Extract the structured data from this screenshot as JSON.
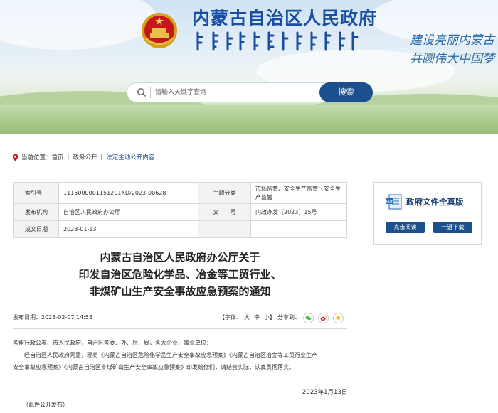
{
  "header": {
    "site_title": "内蒙古自治区人民政府",
    "slogan_line1": "建设亮丽内蒙古",
    "slogan_line2": "共圆伟大中国梦"
  },
  "search": {
    "placeholder": "请输入关键字查询",
    "button_label": "搜索"
  },
  "breadcrumb": {
    "prefix": "当前位置：",
    "items": [
      "首页",
      "政务公开",
      "法定主动公开内容"
    ]
  },
  "meta": {
    "index_label": "索引号",
    "index_value": "1115000001151201XD/2023-00628",
    "category_label": "主题分类",
    "category_value": "市场监管、安全生产监管＼安全生产监管",
    "publisher_label": "发布机构",
    "publisher_value": "自治区人民政府办公厅",
    "docno_label": "文　　号",
    "docno_value": "内政办发〔2023〕15号",
    "date_label": "成文日期",
    "date_value": "2023-01-13"
  },
  "side_panel": {
    "title": "政府文件全真版",
    "read_button": "点击阅读",
    "download_button": "一键下载"
  },
  "document": {
    "title_line1": "内蒙古自治区人民政府办公厅关于",
    "title_line2": "印发自治区危险化学品、冶金等工贸行业、",
    "title_line3": "非煤矿山生产安全事故应急预案的通知",
    "publish_time": "发布日期：2023-02-07 14:55",
    "font_label": "【字体：",
    "font_large": "大",
    "font_medium": "中",
    "font_small": "小】",
    "share_label": "分享到：",
    "salutation": "各盟行政公署、市人民政府，自治区各委、办、厅、局，各大企业、事业单位：",
    "para1_line1": "经自治区人民政府同意，现将《内蒙古自治区危险化学品生产安全事故应急预案》《内蒙古自治区冶金等工贸行业生产",
    "para1_line2": "安全事故应急预案》《内蒙古自治区非煤矿山生产安全事故应急预案》印发给你们，请结合实际，认真贯彻落实。",
    "sign_date": "2023年1月13日",
    "footnote": "（此件公开发布）"
  },
  "colors": {
    "primary": "#1c4f8d",
    "title_blue": "#1a4ea3"
  }
}
